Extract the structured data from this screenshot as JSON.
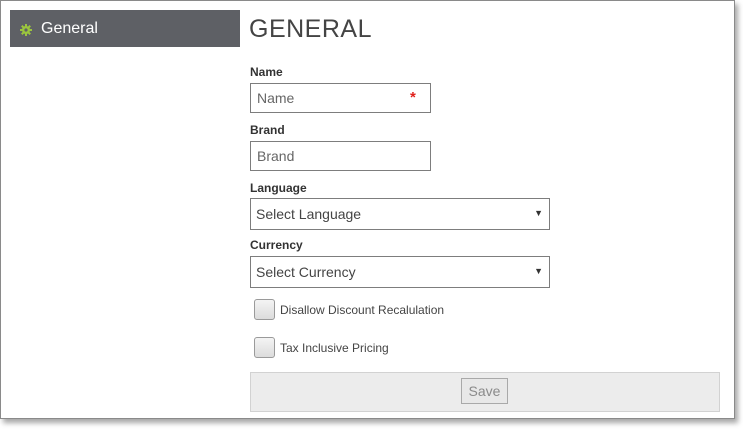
{
  "sidebar": {
    "items": [
      {
        "label": "General",
        "icon": "gear-icon",
        "active": true
      }
    ]
  },
  "main": {
    "title": "GENERAL",
    "fields": {
      "name": {
        "label": "Name",
        "placeholder": "Name",
        "value": "",
        "required_marker": "*"
      },
      "brand": {
        "label": "Brand",
        "placeholder": "Brand",
        "value": ""
      },
      "language": {
        "label": "Language",
        "selected": "Select Language"
      },
      "currency": {
        "label": "Currency",
        "selected": "Select Currency"
      }
    },
    "checkboxes": {
      "disallow_discount": {
        "label": "Disallow Discount Recalulation",
        "checked": false
      },
      "tax_inclusive": {
        "label": "Tax Inclusive Pricing",
        "checked": false
      }
    },
    "footer": {
      "save_label": "Save"
    }
  },
  "colors": {
    "sidebar_bg": "#5e6065",
    "gear_icon": "#9bc53d",
    "required": "#e0201b"
  }
}
